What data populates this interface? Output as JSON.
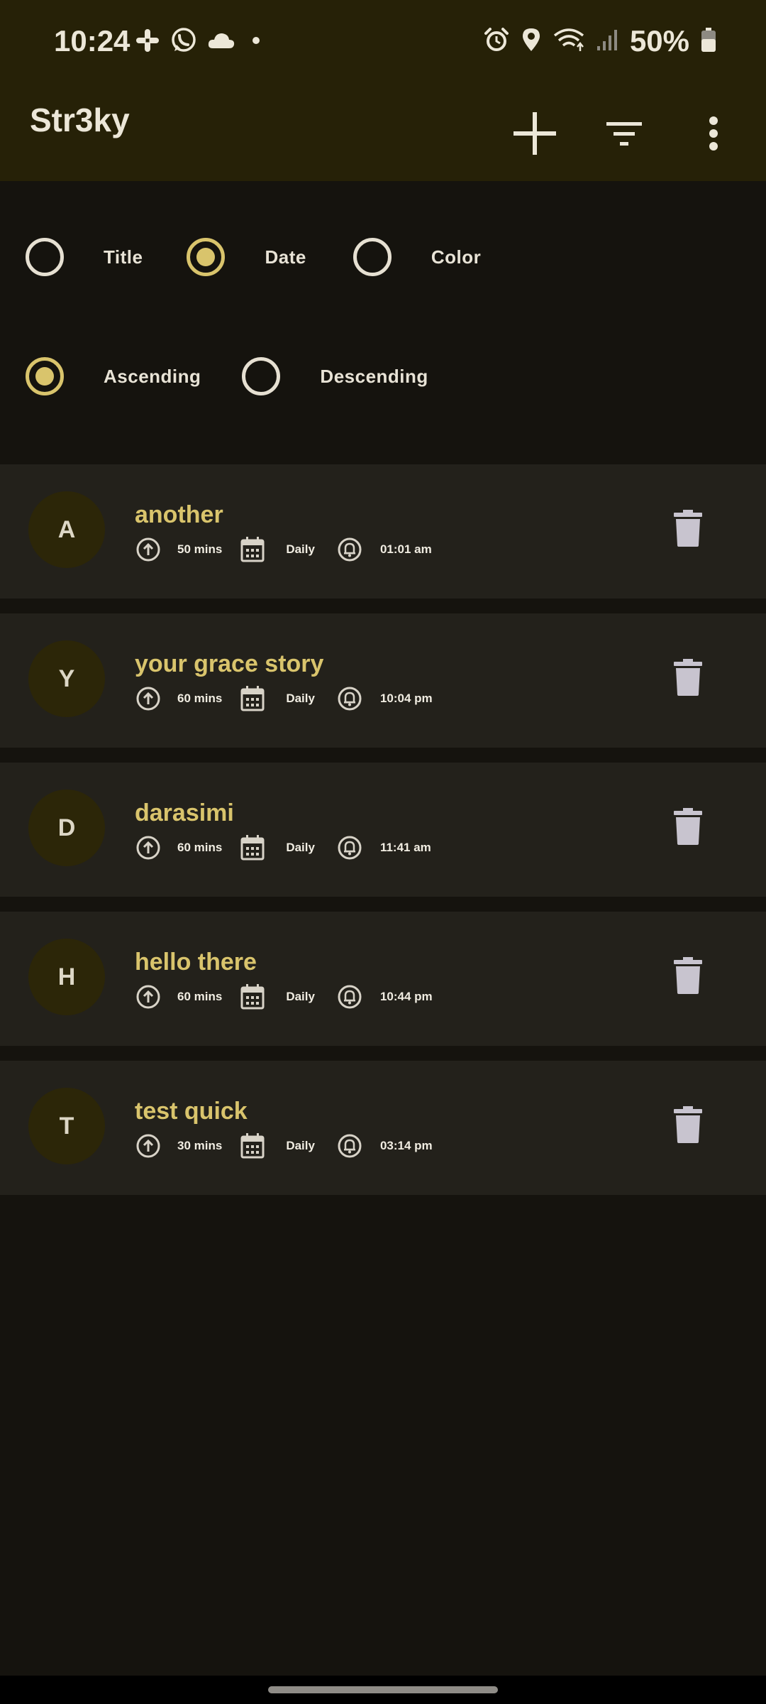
{
  "status_bar": {
    "time": "10:24",
    "battery": "50%",
    "left_icons": [
      "slack-icon",
      "whatsapp-icon",
      "cloud-icon",
      "dot-icon"
    ],
    "right_icons": [
      "alarm-icon",
      "location-icon",
      "wifi-icon",
      "signal-icon",
      "battery-icon"
    ]
  },
  "app_bar": {
    "title": "Str3ky",
    "actions": [
      "add-icon",
      "filter-icon",
      "more-vert-icon"
    ]
  },
  "sort": {
    "by_options": [
      {
        "label": "Title",
        "checked": false
      },
      {
        "label": "Date",
        "checked": true
      },
      {
        "label": "Color",
        "checked": false
      }
    ],
    "order_options": [
      {
        "label": "Ascending",
        "checked": true
      },
      {
        "label": "Descending",
        "checked": false
      }
    ]
  },
  "habits": [
    {
      "initial": "A",
      "title": "another",
      "duration": "50 mins",
      "frequency": "Daily",
      "reminder": "01:01 am"
    },
    {
      "initial": "Y",
      "title": "your grace story",
      "duration": "60 mins",
      "frequency": "Daily",
      "reminder": "10:04 pm"
    },
    {
      "initial": "D",
      "title": "darasimi",
      "duration": "60 mins",
      "frequency": "Daily",
      "reminder": "11:41 am"
    },
    {
      "initial": "H",
      "title": "hello there",
      "duration": "60 mins",
      "frequency": "Daily",
      "reminder": "10:44 pm"
    },
    {
      "initial": "T",
      "title": "test quick",
      "duration": "30 mins",
      "frequency": "Daily",
      "reminder": "03:14 pm"
    }
  ],
  "colors": {
    "accent": "#d9c46c",
    "app_bar_bg": "#262107",
    "background": "#15130e",
    "card_bg": "#23211b"
  }
}
